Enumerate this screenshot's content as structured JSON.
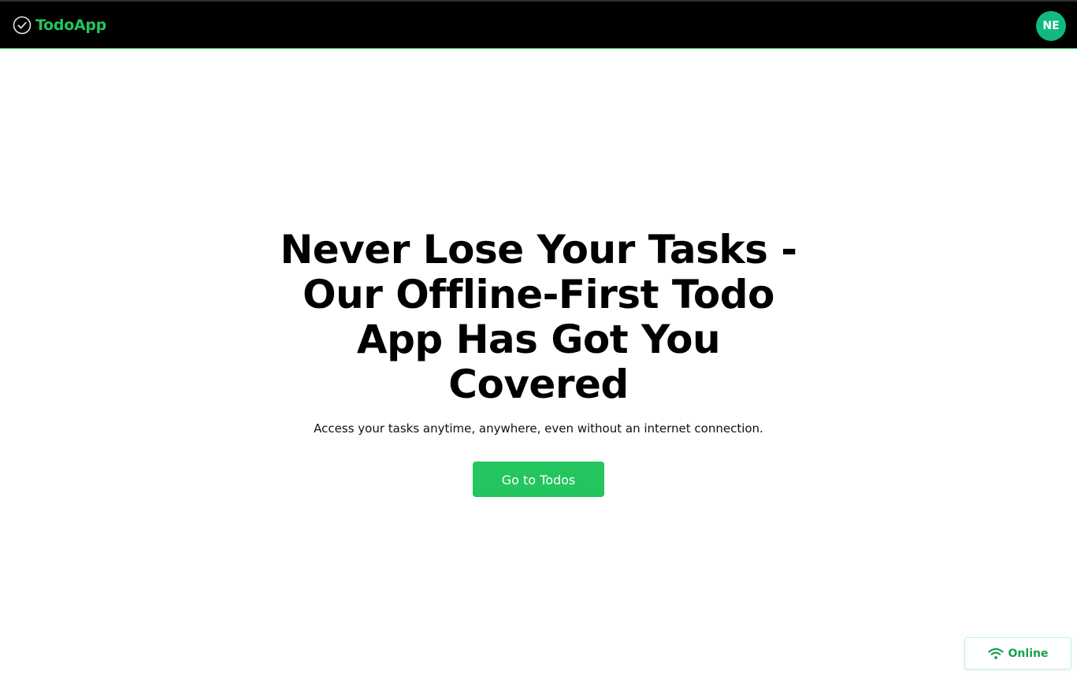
{
  "header": {
    "brand_name": "TodoApp",
    "brand_icon": "check-circle-icon",
    "avatar_initials": "NE"
  },
  "hero": {
    "title": "Never Lose Your Tasks - Our Offline-First Todo App Has Got You Covered",
    "subtitle": "Access your tasks anytime, anywhere, even without an internet connection.",
    "cta_label": "Go to Todos"
  },
  "status": {
    "label": "Online",
    "icon": "wifi-icon"
  },
  "colors": {
    "accent": "#22c55e",
    "avatar_bg": "#10b981",
    "header_bg": "#000000",
    "status_text": "#16a34a"
  }
}
